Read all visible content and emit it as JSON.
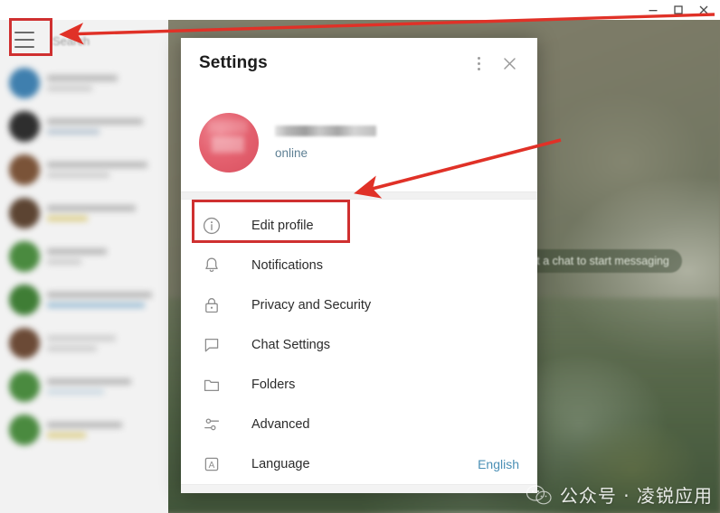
{
  "window": {
    "controls": [
      {
        "name": "minimize",
        "glyph": "minimize-icon"
      },
      {
        "name": "maximize",
        "glyph": "maximize-icon"
      },
      {
        "name": "close",
        "glyph": "close-icon"
      }
    ]
  },
  "sidebar": {
    "menu_icon": "hamburger-icon",
    "search_placeholder": "Search",
    "chats_redacted": true,
    "chat_rows": [
      {
        "avatar_color": "#3f7fae"
      },
      {
        "avatar_color": "#2e2e2e"
      },
      {
        "avatar_color": "#7a5338"
      },
      {
        "avatar_color": "#5c4432"
      },
      {
        "avatar_color": "#4a8a3f"
      },
      {
        "avatar_color": "#3f7d35"
      },
      {
        "avatar_color": "#6b4a36"
      },
      {
        "avatar_color": "#4a8a3f"
      },
      {
        "avatar_color": "#4a8a3f"
      }
    ]
  },
  "main": {
    "placeholder_badge": "Select a chat to start messaging"
  },
  "dialog": {
    "title": "Settings",
    "more_icon": "kebab-menu-icon",
    "close_icon": "close-icon",
    "profile": {
      "avatar_icon": "user-avatar",
      "username_redacted": true,
      "status": "online"
    },
    "menu_items": [
      {
        "icon": "info-circle-icon",
        "label": "Edit profile",
        "value": "",
        "highlighted": true
      },
      {
        "icon": "bell-icon",
        "label": "Notifications",
        "value": "",
        "highlighted": false
      },
      {
        "icon": "lock-icon",
        "label": "Privacy and Security",
        "value": "",
        "highlighted": false
      },
      {
        "icon": "chat-bubble-icon",
        "label": "Chat Settings",
        "value": "",
        "highlighted": false
      },
      {
        "icon": "folder-icon",
        "label": "Folders",
        "value": "",
        "highlighted": false
      },
      {
        "icon": "sliders-icon",
        "label": "Advanced",
        "value": "",
        "highlighted": false
      },
      {
        "icon": "letter-a-icon",
        "label": "Language",
        "value": "English",
        "highlighted": false
      }
    ]
  },
  "annotations": {
    "accent_color": "#cf3030",
    "highlight_boxes": [
      {
        "target": "hamburger-menu-button"
      },
      {
        "target": "edit-profile-row"
      }
    ],
    "arrows": [
      {
        "from": "right-edge-top",
        "to": "hamburger-menu-button"
      },
      {
        "from": "right-edge-mid",
        "to": "edit-profile-row"
      }
    ]
  },
  "watermark": {
    "logo": "wechat-logo-icon",
    "text": "公众号 · 凌锐应用"
  }
}
